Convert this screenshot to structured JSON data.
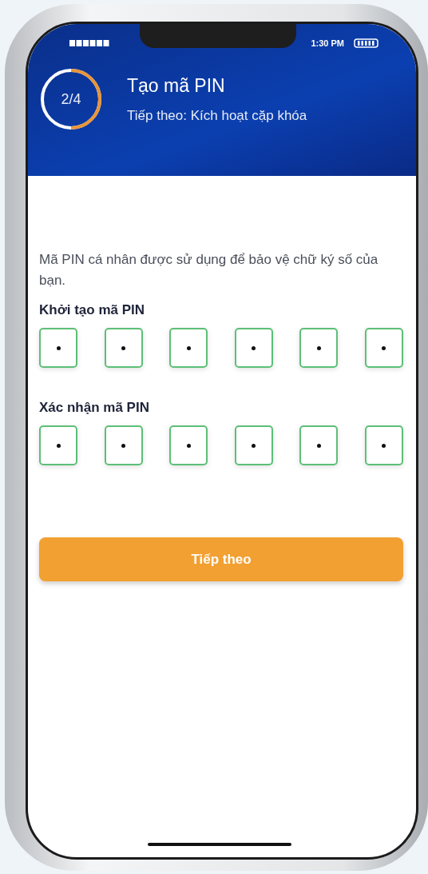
{
  "status_bar": {
    "time": "1:30 PM"
  },
  "header": {
    "step": "2/4",
    "level": 0.5,
    "title": "Tạo mã PIN",
    "subtitle": "Tiếp theo: Kích hoạt cặp khóa"
  },
  "description": "Mã PIN cá nhân được sử dụng để bảo vệ chữ ký số của bạn.",
  "pin_groups": [
    {
      "label": "Khởi tạo mã PIN",
      "digits": [
        {
          "filled": true
        },
        {
          "filled": true
        },
        {
          "filled": true
        },
        {
          "filled": true
        },
        {
          "filled": true
        },
        {
          "filled": true
        }
      ]
    },
    {
      "label": "Xác nhận mã PIN",
      "digits": [
        {
          "filled": true
        },
        {
          "filled": true
        },
        {
          "filled": true
        },
        {
          "filled": true
        },
        {
          "filled": true
        },
        {
          "filled": true
        }
      ]
    }
  ],
  "button": "Tiếp theo"
}
